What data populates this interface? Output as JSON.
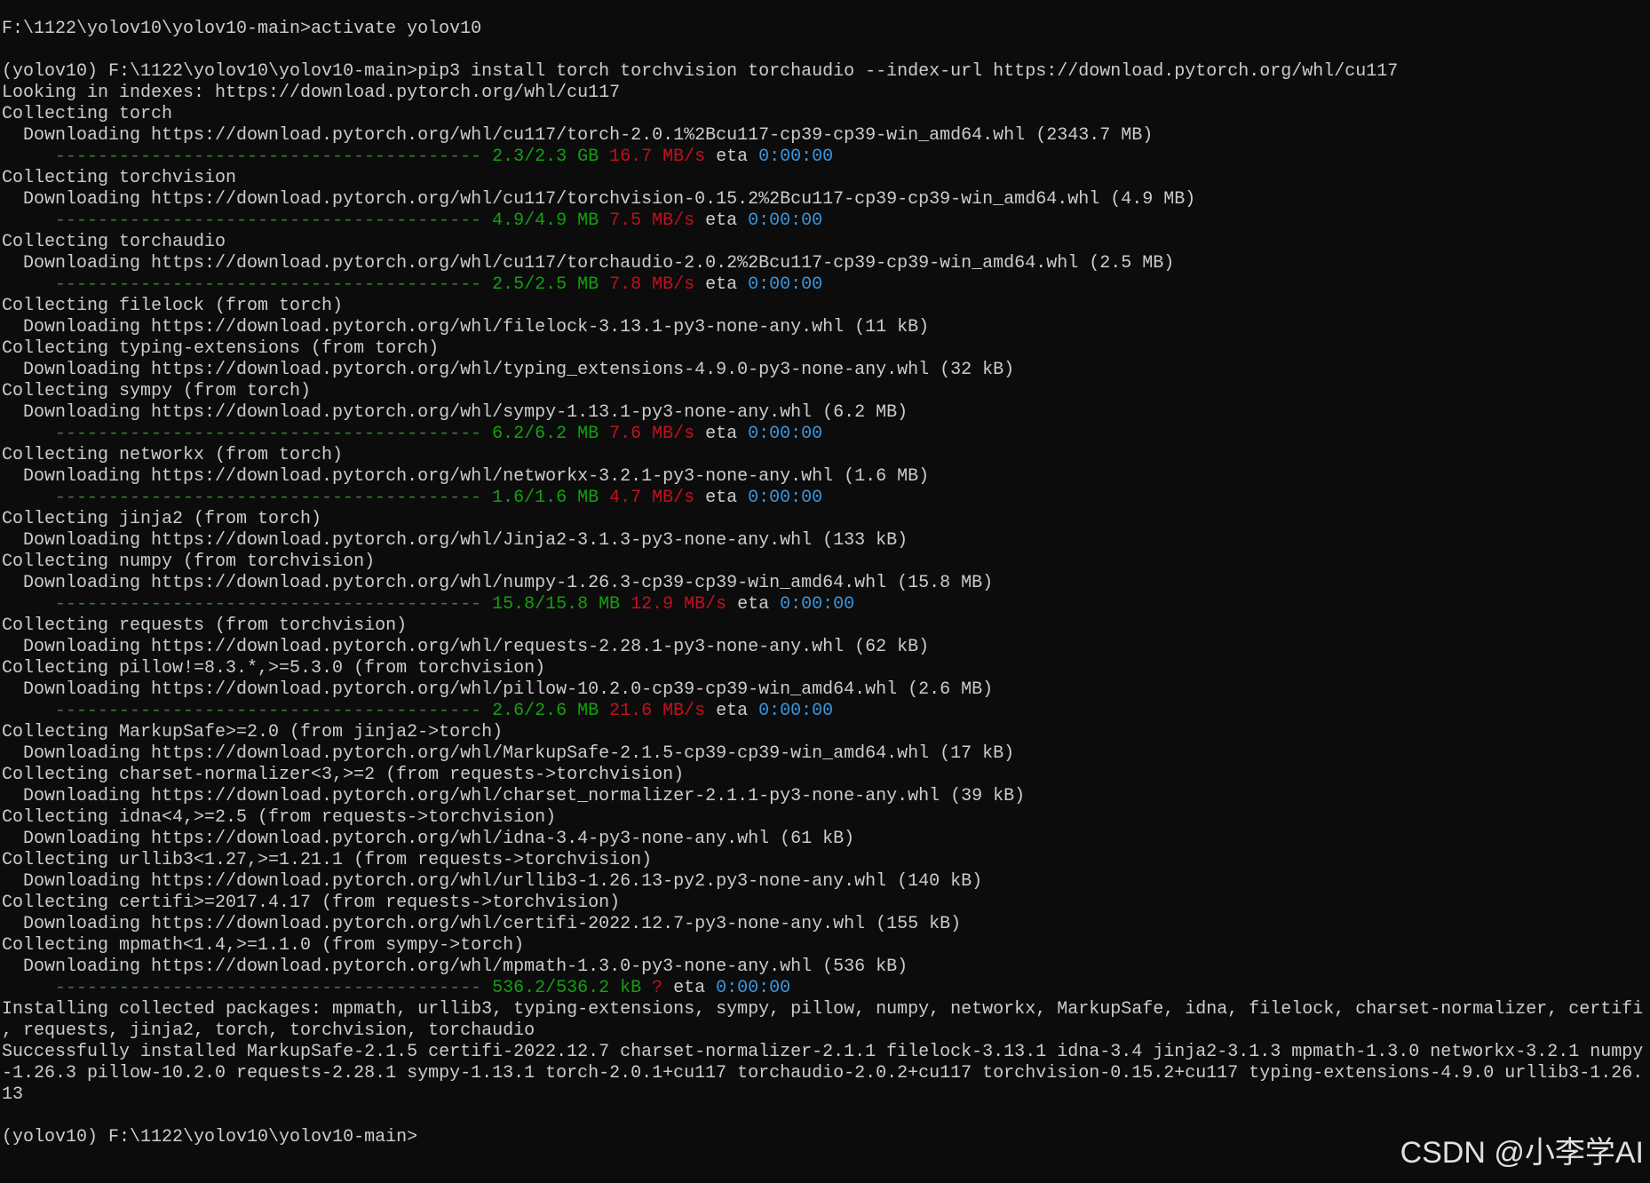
{
  "colors": {
    "background": "#0c0c0c",
    "text": "#cccccc",
    "progress_bar": "#3c7f33",
    "progress_amount": "#13a10e",
    "progress_speed": "#c50f1f",
    "progress_eta": "#3a96dd",
    "watermark": "#e0e0e0"
  },
  "terminal": {
    "lines": [
      {
        "text": "F:\\1122\\yolov10\\yolov10-main>activate yolov10"
      },
      {
        "text": ""
      },
      {
        "text": "(yolov10) F:\\1122\\yolov10\\yolov10-main>pip3 install torch torchvision torchaudio --index-url https://download.pytorch.org/whl/cu117"
      },
      {
        "text": "Looking in indexes: https://download.pytorch.org/whl/cu117"
      },
      {
        "text": "Collecting torch"
      },
      {
        "text": "  Downloading https://download.pytorch.org/whl/cu117/torch-2.0.1%2Bcu117-cp39-cp39-win_amd64.whl (2343.7 MB)"
      },
      {
        "progress": {
          "bar": "----------------------------------------",
          "amount": "2.3/2.3 GB",
          "speed": "16.7 MB/s",
          "eta_label": "eta",
          "eta": "0:00:00"
        }
      },
      {
        "text": "Collecting torchvision"
      },
      {
        "text": "  Downloading https://download.pytorch.org/whl/cu117/torchvision-0.15.2%2Bcu117-cp39-cp39-win_amd64.whl (4.9 MB)"
      },
      {
        "progress": {
          "bar": "----------------------------------------",
          "amount": "4.9/4.9 MB",
          "speed": "7.5 MB/s",
          "eta_label": "eta",
          "eta": "0:00:00"
        }
      },
      {
        "text": "Collecting torchaudio"
      },
      {
        "text": "  Downloading https://download.pytorch.org/whl/cu117/torchaudio-2.0.2%2Bcu117-cp39-cp39-win_amd64.whl (2.5 MB)"
      },
      {
        "progress": {
          "bar": "----------------------------------------",
          "amount": "2.5/2.5 MB",
          "speed": "7.8 MB/s",
          "eta_label": "eta",
          "eta": "0:00:00"
        }
      },
      {
        "text": "Collecting filelock (from torch)"
      },
      {
        "text": "  Downloading https://download.pytorch.org/whl/filelock-3.13.1-py3-none-any.whl (11 kB)"
      },
      {
        "text": "Collecting typing-extensions (from torch)"
      },
      {
        "text": "  Downloading https://download.pytorch.org/whl/typing_extensions-4.9.0-py3-none-any.whl (32 kB)"
      },
      {
        "text": "Collecting sympy (from torch)"
      },
      {
        "text": "  Downloading https://download.pytorch.org/whl/sympy-1.13.1-py3-none-any.whl (6.2 MB)"
      },
      {
        "progress": {
          "bar": "----------------------------------------",
          "amount": "6.2/6.2 MB",
          "speed": "7.6 MB/s",
          "eta_label": "eta",
          "eta": "0:00:00"
        }
      },
      {
        "text": "Collecting networkx (from torch)"
      },
      {
        "text": "  Downloading https://download.pytorch.org/whl/networkx-3.2.1-py3-none-any.whl (1.6 MB)"
      },
      {
        "progress": {
          "bar": "----------------------------------------",
          "amount": "1.6/1.6 MB",
          "speed": "4.7 MB/s",
          "eta_label": "eta",
          "eta": "0:00:00"
        }
      },
      {
        "text": "Collecting jinja2 (from torch)"
      },
      {
        "text": "  Downloading https://download.pytorch.org/whl/Jinja2-3.1.3-py3-none-any.whl (133 kB)"
      },
      {
        "text": "Collecting numpy (from torchvision)"
      },
      {
        "text": "  Downloading https://download.pytorch.org/whl/numpy-1.26.3-cp39-cp39-win_amd64.whl (15.8 MB)"
      },
      {
        "progress": {
          "bar": "----------------------------------------",
          "amount": "15.8/15.8 MB",
          "speed": "12.9 MB/s",
          "eta_label": "eta",
          "eta": "0:00:00"
        }
      },
      {
        "text": "Collecting requests (from torchvision)"
      },
      {
        "text": "  Downloading https://download.pytorch.org/whl/requests-2.28.1-py3-none-any.whl (62 kB)"
      },
      {
        "text": "Collecting pillow!=8.3.*,>=5.3.0 (from torchvision)"
      },
      {
        "text": "  Downloading https://download.pytorch.org/whl/pillow-10.2.0-cp39-cp39-win_amd64.whl (2.6 MB)"
      },
      {
        "progress": {
          "bar": "----------------------------------------",
          "amount": "2.6/2.6 MB",
          "speed": "21.6 MB/s",
          "eta_label": "eta",
          "eta": "0:00:00"
        }
      },
      {
        "text": "Collecting MarkupSafe>=2.0 (from jinja2->torch)"
      },
      {
        "text": "  Downloading https://download.pytorch.org/whl/MarkupSafe-2.1.5-cp39-cp39-win_amd64.whl (17 kB)"
      },
      {
        "text": "Collecting charset-normalizer<3,>=2 (from requests->torchvision)"
      },
      {
        "text": "  Downloading https://download.pytorch.org/whl/charset_normalizer-2.1.1-py3-none-any.whl (39 kB)"
      },
      {
        "text": "Collecting idna<4,>=2.5 (from requests->torchvision)"
      },
      {
        "text": "  Downloading https://download.pytorch.org/whl/idna-3.4-py3-none-any.whl (61 kB)"
      },
      {
        "text": "Collecting urllib3<1.27,>=1.21.1 (from requests->torchvision)"
      },
      {
        "text": "  Downloading https://download.pytorch.org/whl/urllib3-1.26.13-py2.py3-none-any.whl (140 kB)"
      },
      {
        "text": "Collecting certifi>=2017.4.17 (from requests->torchvision)"
      },
      {
        "text": "  Downloading https://download.pytorch.org/whl/certifi-2022.12.7-py3-none-any.whl (155 kB)"
      },
      {
        "text": "Collecting mpmath<1.4,>=1.1.0 (from sympy->torch)"
      },
      {
        "text": "  Downloading https://download.pytorch.org/whl/mpmath-1.3.0-py3-none-any.whl (536 kB)"
      },
      {
        "progress": {
          "bar": "----------------------------------------",
          "amount": "536.2/536.2 kB",
          "speed": "?",
          "eta_label": "eta",
          "eta": "0:00:00"
        }
      },
      {
        "text": "Installing collected packages: mpmath, urllib3, typing-extensions, sympy, pillow, numpy, networkx, MarkupSafe, idna, filelock, charset-normalizer, certifi"
      },
      {
        "text": ", requests, jinja2, torch, torchvision, torchaudio"
      },
      {
        "text": "Successfully installed MarkupSafe-2.1.5 certifi-2022.12.7 charset-normalizer-2.1.1 filelock-3.13.1 idna-3.4 jinja2-3.1.3 mpmath-1.3.0 networkx-3.2.1 numpy"
      },
      {
        "text": "-1.26.3 pillow-10.2.0 requests-2.28.1 sympy-1.13.1 torch-2.0.1+cu117 torchaudio-2.0.2+cu117 torchvision-0.15.2+cu117 typing-extensions-4.9.0 urllib3-1.26."
      },
      {
        "text": "13"
      },
      {
        "text": ""
      },
      {
        "text": "(yolov10) F:\\1122\\yolov10\\yolov10-main>"
      }
    ]
  },
  "watermark": "CSDN @小李学AI"
}
